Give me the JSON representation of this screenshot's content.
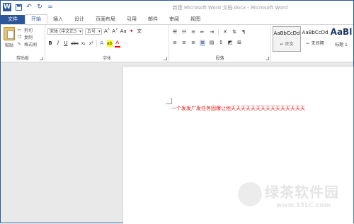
{
  "window": {
    "title": "新建 Microsoft Word 文档.docx - Microsoft Word"
  },
  "qat": {
    "logo": "W",
    "icons": [
      "save-icon",
      "undo-icon",
      "redo-icon",
      "customize-icon"
    ]
  },
  "tabs": [
    {
      "label": "文件"
    },
    {
      "label": "开始"
    },
    {
      "label": "插入"
    },
    {
      "label": "设计"
    },
    {
      "label": "页面布局"
    },
    {
      "label": "引用"
    },
    {
      "label": "邮件"
    },
    {
      "label": "审阅"
    },
    {
      "label": "视图"
    }
  ],
  "clipboard": {
    "paste": "粘贴",
    "cut": "剪切",
    "copy": "复制",
    "format_painter": "格式刷",
    "group": "剪贴板"
  },
  "font": {
    "name": "宋体 (中文正3",
    "size": "五号",
    "grow": "A˄",
    "shrink": "A˅",
    "case": "Aa",
    "bold": "B",
    "italic": "I",
    "underline": "U",
    "strike": "abc",
    "sub": "x₂",
    "sup": "x²",
    "effects": "A",
    "highlight": "ab",
    "color": "A",
    "group": "字体"
  },
  "paragraph": {
    "group": "段落"
  },
  "styles": {
    "items": [
      {
        "preview": "AaBbCcDd",
        "name": "↵ 正文"
      },
      {
        "preview": "AaBbCcDd",
        "name": "↵ 无间隔"
      },
      {
        "preview": "AaBl",
        "name": "标题 1"
      }
    ]
  },
  "document": {
    "text": "一个发发广发任务固爆让他天天天天天天天天天天天天天天天"
  },
  "watermark": {
    "text": "绿茶软件园",
    "url": "www.33LC.com"
  }
}
